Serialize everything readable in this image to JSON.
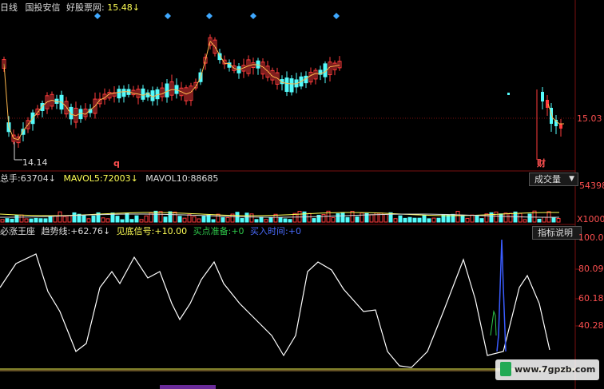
{
  "colors": {
    "up": "#ff3c3c",
    "down": "#54fcfc",
    "ma": "#ffb84d",
    "white": "#ffffff",
    "yellow": "#ffff55",
    "grid": "#7a1010",
    "cyan_diamond": "#3fa8ff",
    "green": "#2ec84a",
    "blue": "#3a5cff"
  },
  "header": {
    "fragment": "日线",
    "stock": "国投安信",
    "site": "好股票网:",
    "price": "15.48",
    "arrow": "↓"
  },
  "price_panel": {
    "low_label": "14.14",
    "right_level": "15.03",
    "marker_q": "q",
    "marker_cai": "财"
  },
  "volume_panel": {
    "vol_label": "总手:",
    "vol_value": "63704",
    "mavol5_label": "MAVOL5:",
    "mavol5_value": "72003",
    "mavol10_label": "MAVOL10:",
    "mavol10_value": "88685",
    "arrow": "↓",
    "dropdown_label": "成交量",
    "dropdown_icon": "chevron-down-icon",
    "axis_top": "54398",
    "axis_bottom": "X1000"
  },
  "indicator_panel": {
    "name": "必涨王座",
    "trend_label": "趋势线:",
    "trend_value": "+62.76",
    "arrow": "↓",
    "bottom_label": "见底信号:",
    "bottom_value": "+10.00",
    "buy_ready_label": "买点准备:",
    "buy_ready_value": "+0",
    "buy_time_label": "买入时间:",
    "buy_time_value": "+0",
    "button": "指标说明",
    "axis": [
      "100.00",
      "80.09",
      "60.18",
      "40.28"
    ]
  },
  "watermark": "www.7gpzb.com"
}
